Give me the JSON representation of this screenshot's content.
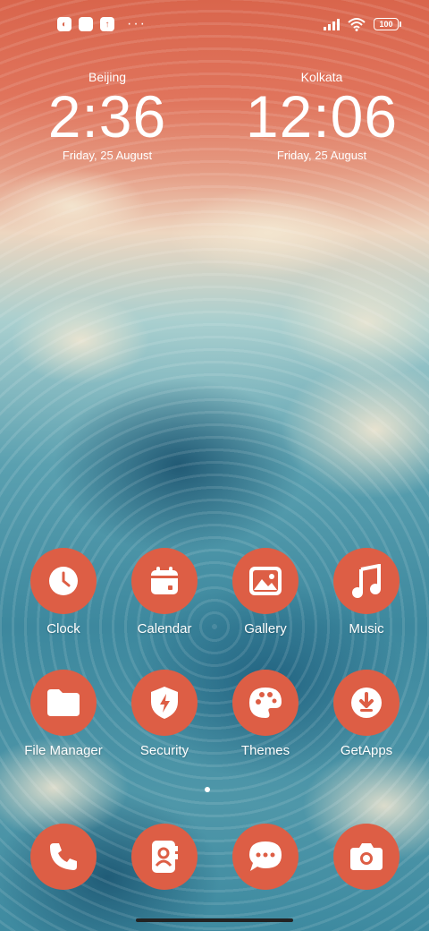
{
  "status_bar": {
    "left_icons": [
      "sim-icon",
      "notification-square-icon",
      "upload-icon"
    ],
    "overflow": "···",
    "battery": "100"
  },
  "clocks": [
    {
      "city": "Beijing",
      "time": "2:36",
      "date": "Friday, 25 August"
    },
    {
      "city": "Kolkata",
      "time": "12:06",
      "date": "Friday, 25 August"
    }
  ],
  "apps": {
    "row1": [
      {
        "label": "Clock",
        "icon": "clock-icon"
      },
      {
        "label": "Calendar",
        "icon": "calendar-icon"
      },
      {
        "label": "Gallery",
        "icon": "gallery-icon"
      },
      {
        "label": "Music",
        "icon": "music-icon"
      }
    ],
    "row2": [
      {
        "label": "File Manager",
        "icon": "folder-icon"
      },
      {
        "label": "Security",
        "icon": "shield-icon"
      },
      {
        "label": "Themes",
        "icon": "palette-icon"
      },
      {
        "label": "GetApps",
        "icon": "download-icon"
      }
    ]
  },
  "dock": [
    {
      "icon": "phone-icon"
    },
    {
      "icon": "contacts-icon"
    },
    {
      "icon": "messages-icon"
    },
    {
      "icon": "camera-icon"
    }
  ],
  "colors": {
    "icon_bg": "#dd5e45",
    "sky": "#d9654c",
    "sea": "#3d889e"
  }
}
